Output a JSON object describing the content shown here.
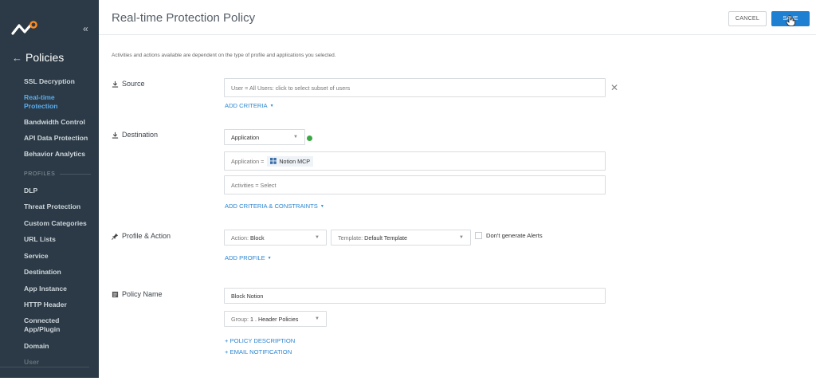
{
  "sidebar": {
    "back_label": "Policies",
    "items_top": [
      {
        "label": "SSL Decryption",
        "active": false
      },
      {
        "label": "Real-time Protection",
        "active": true
      },
      {
        "label": "Bandwidth Control",
        "active": false
      },
      {
        "label": "API Data Protection",
        "active": false
      },
      {
        "label": "Behavior Analytics",
        "active": false
      }
    ],
    "section_profiles": "PROFILES",
    "items_profiles": [
      {
        "label": "DLP"
      },
      {
        "label": "Threat Protection"
      },
      {
        "label": "Custom Categories"
      },
      {
        "label": "URL Lists"
      },
      {
        "label": "Service"
      },
      {
        "label": "Destination"
      },
      {
        "label": "App Instance"
      },
      {
        "label": "HTTP Header"
      },
      {
        "label": "Connected App/Plugin"
      },
      {
        "label": "Domain"
      },
      {
        "label": "User"
      }
    ]
  },
  "header": {
    "title": "Real-time Protection Policy",
    "cancel_label": "CANCEL",
    "save_label": "SAVE"
  },
  "hint": "Activities and actions available are dependent on the type of profile and applications you selected.",
  "source": {
    "label": "Source",
    "field_text": "User = All Users: click to select subset of users",
    "add_criteria": "ADD CRITERIA"
  },
  "destination": {
    "label": "Destination",
    "type_select": "Application",
    "app_prefix": "Application =",
    "app_chip": "Notion MCP",
    "activities": "Activities = Select",
    "add_criteria": "ADD CRITERIA & CONSTRAINTS"
  },
  "profile_action": {
    "label": "Profile & Action",
    "action_prefix": "Action:",
    "action_value": "Block",
    "template_prefix": "Template:",
    "template_value": "Default Template",
    "no_alerts_label": "Don't generate Alerts",
    "add_profile": "ADD PROFILE"
  },
  "policy_name": {
    "label": "Policy Name",
    "value": "Block Notion",
    "group_prefix": "Group:",
    "group_value": "1 . Header Policies",
    "add_description": "+ POLICY DESCRIPTION",
    "add_email": "+ EMAIL NOTIFICATION"
  },
  "colors": {
    "sidebar_bg": "#2b3a46",
    "accent": "#1f7fd1",
    "active_nav": "#5aaef0",
    "status_green": "#3aa844"
  }
}
